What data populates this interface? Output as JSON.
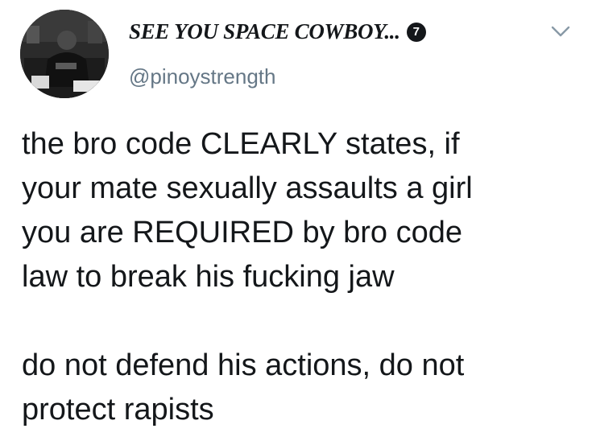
{
  "tweet": {
    "display_name": "SEE YOU SPACE COWBOY...",
    "badge": "7",
    "handle": "@pinoystrength",
    "paragraphs": [
      "the bro code CLEARLY states, if\nyour mate sexually assaults a girl\nyou are REQUIRED by bro code\nlaw to break his fucking jaw",
      "do not defend his actions, do not\nprotect rapists"
    ]
  },
  "icons": {
    "menu": "chevron-down-icon"
  },
  "colors": {
    "text": "#14171a",
    "secondary": "#657786",
    "chevron": "#8899a6",
    "background": "#ffffff"
  }
}
